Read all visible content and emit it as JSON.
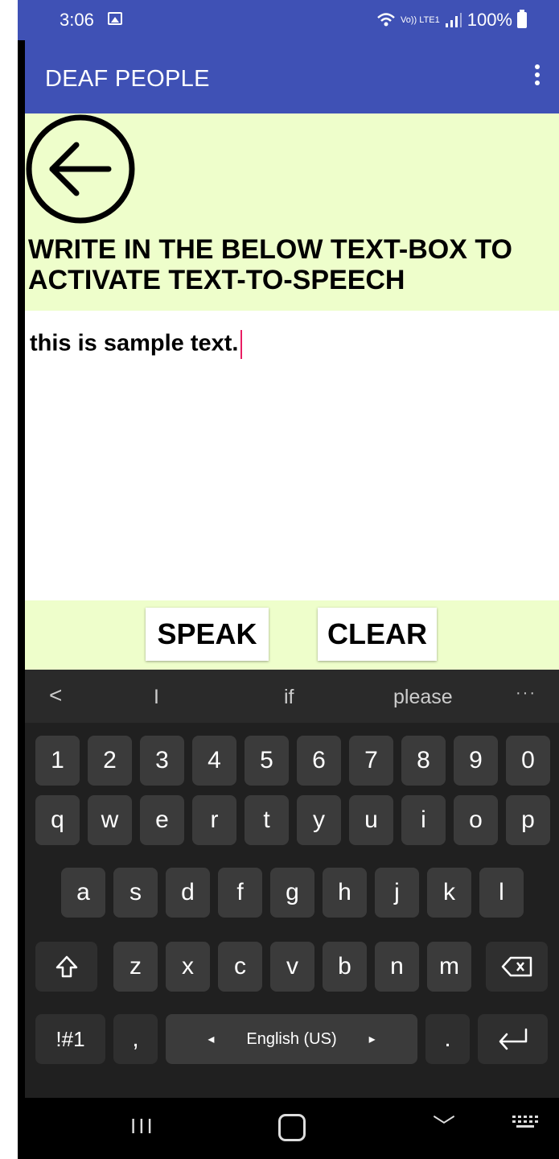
{
  "status": {
    "time": "3:06",
    "network": "Vo)) LTE1",
    "battery": "100%"
  },
  "app_bar": {
    "title": "DEAF PEOPLE"
  },
  "instruction": "WRITE IN THE BELOW TEXT-BOX TO ACTIVATE TEXT-TO-SPEECH",
  "text_box": {
    "value": "this is sample text."
  },
  "buttons": {
    "speak": "SPEAK",
    "clear": "CLEAR"
  },
  "keyboard": {
    "suggestions": [
      "I",
      "if",
      "please"
    ],
    "back": "<",
    "more": "···",
    "row1": [
      "1",
      "2",
      "3",
      "4",
      "5",
      "6",
      "7",
      "8",
      "9",
      "0"
    ],
    "row2": [
      "q",
      "w",
      "e",
      "r",
      "t",
      "y",
      "u",
      "i",
      "o",
      "p"
    ],
    "row3": [
      "a",
      "s",
      "d",
      "f",
      "g",
      "h",
      "j",
      "k",
      "l"
    ],
    "row4": [
      "z",
      "x",
      "c",
      "v",
      "b",
      "n",
      "m"
    ],
    "symbols": "!#1",
    "comma": ",",
    "space": "English (US)",
    "period": ".",
    "language_left": "◂",
    "language_right": "▸"
  },
  "nav": {
    "recent": "III",
    "back": "﹀"
  },
  "colors": {
    "app_bar": "#3f51b5",
    "content_bg": "#eefecb",
    "caret": "#e91e63",
    "keyboard_bg": "#202020"
  }
}
